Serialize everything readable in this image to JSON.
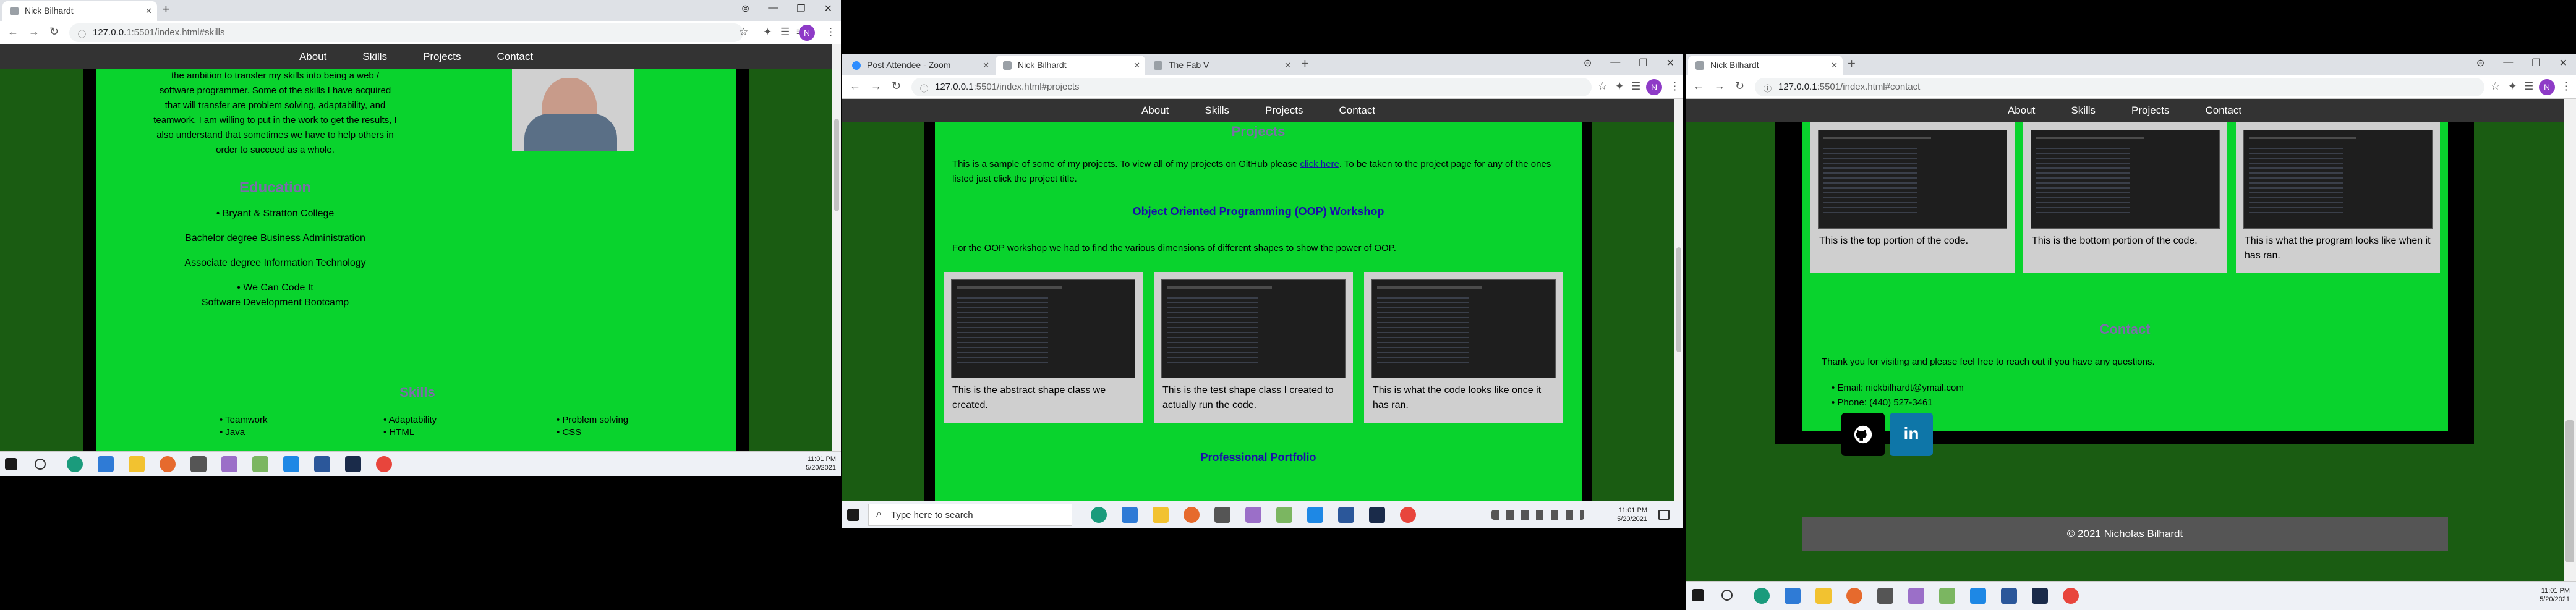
{
  "windows": [
    {
      "tabs": [
        {
          "title": "Nick Bilhardt"
        }
      ],
      "url_host": "127.0.0.1",
      "url_path": ":5501/index.html#skills",
      "profile": "N",
      "nav": [
        "About",
        "Skills",
        "Projects",
        "Contact"
      ],
      "about_lines": [
        "the ambition to transfer my skills into being a web /",
        "software programmer. Some of the skills I have acquired",
        "that will transfer are problem solving, adaptability, and",
        "teamwork. I am willing to put in the work to get the results, I",
        "also understand that sometimes we have to help others in",
        "order to succeed as a whole."
      ],
      "education_title": "Education",
      "education": [
        "Bryant & Stratton College",
        "Bachelor degree Business Administration",
        "Associate degree Information Technology",
        "We Can Code It",
        "Software Development Bootcamp"
      ],
      "skills_title": "Skills",
      "skills": [
        [
          "Teamwork",
          "Java"
        ],
        [
          "Adaptability",
          "HTML"
        ],
        [
          "Problem solving",
          "CSS"
        ]
      ],
      "clock": {
        "time": "11:01 PM",
        "date": "5/20/2021"
      }
    },
    {
      "tabs": [
        {
          "title": "Post Attendee - Zoom"
        },
        {
          "title": "Nick Bilhardt"
        },
        {
          "title": "The Fab V"
        }
      ],
      "url_host": "127.0.0.1",
      "url_path": ":5501/index.html#projects",
      "profile": "N",
      "nav": [
        "About",
        "Skills",
        "Projects",
        "Contact"
      ],
      "projects_title": "Projects",
      "intro_a": "This is a sample of some of my projects. To view all of my projects on GitHub please ",
      "intro_link": "click here",
      "intro_b": ". To be taken to the project page for any of the ones listed just click the project title.",
      "oop_title": "Object Oriented Programming (OOP) Workshop",
      "oop_desc": "For the OOP workshop we had to find the various dimensions of different shapes to show the power of OOP.",
      "cards": [
        "This is the abstract shape class we created.",
        "This is the test shape class I created to actually run the code.",
        "This is what the code looks like once it has ran."
      ],
      "portfolio_title": "Professional Portfolio",
      "search_placeholder": "Type here to search",
      "clock": {
        "time": "11:01 PM",
        "date": "5/20/2021"
      }
    },
    {
      "tabs": [
        {
          "title": "Nick Bilhardt"
        }
      ],
      "url_host": "127.0.0.1",
      "url_path": ":5501/index.html#contact",
      "profile": "N",
      "nav": [
        "About",
        "Skills",
        "Projects",
        "Contact"
      ],
      "cards": [
        "This is the top portion of the code.",
        "This is the bottom portion of the code.",
        "This is what the program looks like when it has ran."
      ],
      "contact_title": "Contact",
      "contact_intro": "Thank you for visiting and please feel free to reach out if you have any questions.",
      "email": "Email: nickbilhardt@ymail.com",
      "phone": "Phone: (440) 527-3461",
      "footer": "© 2021 Nicholas Bilhardt",
      "clock": {
        "time": "11:01 PM",
        "date": "5/20/2021"
      }
    }
  ],
  "colors": {
    "site_green": "#09d32d",
    "outer_green": "#1a5c12",
    "nav_dark": "#333333",
    "heading": "#7b6ea8",
    "github": "#000000",
    "linkedin": "#0e76a8"
  }
}
